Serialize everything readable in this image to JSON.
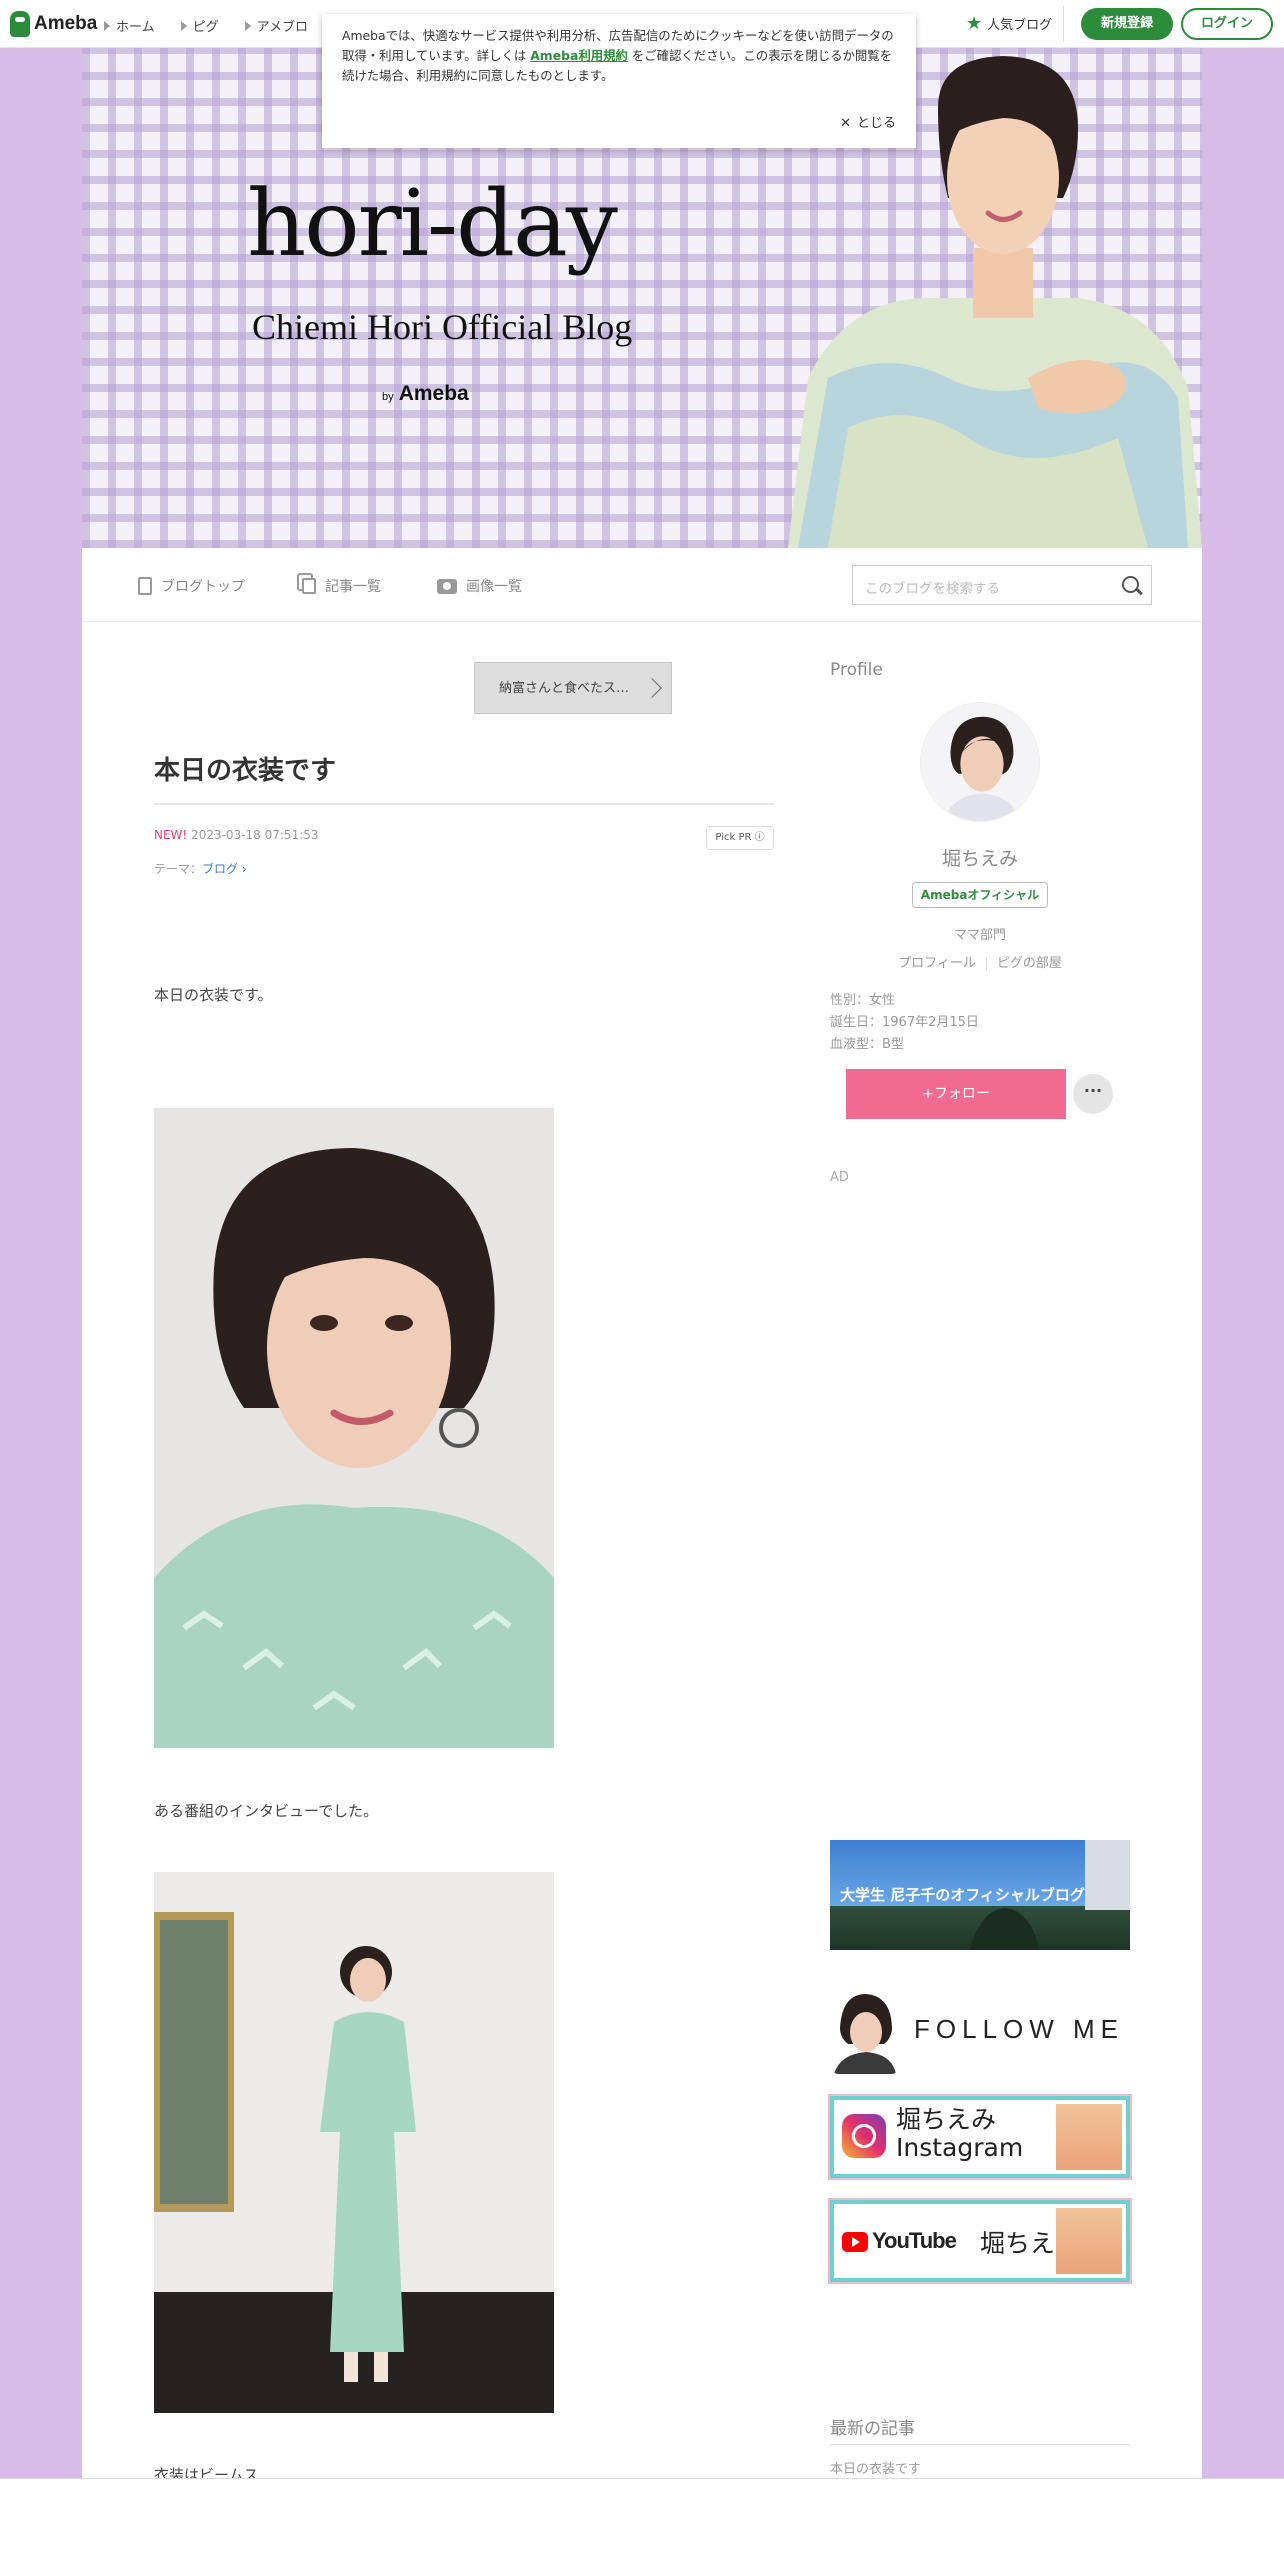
{
  "header": {
    "logo": "Ameba",
    "nav": [
      "ホーム",
      "ピグ",
      "アメブロ"
    ],
    "popular": "人気ブログ",
    "signup": "新規登録",
    "login": "ログイン",
    "accent_color": "#2d8c3c"
  },
  "cookie": {
    "text_before": "Amebaでは、快適なサービス提供や利用分析、広告配信のためにクッキーなどを使い訪問データの取得・利用しています。詳しくは",
    "link": "Ameba利用規約",
    "text_after": "をご確認ください。この表示を閉じるか閲覧を続けた場合、利用規約に同意したものとします。",
    "close": "とじる"
  },
  "banner": {
    "title": "hori-day",
    "subtitle": "Chiemi Hori Official Blog",
    "by": "by",
    "ameba": "Ameba"
  },
  "blognav": {
    "top": "ブログトップ",
    "entries": "記事一覧",
    "images": "画像一覧",
    "search_placeholder": "このブログを検索する"
  },
  "article": {
    "prev_link": "納富さんと食べたス…",
    "title": "本日の衣装です",
    "new_label": "NEW!",
    "date": "2023-03-18 07:51:53",
    "pickpr": "Pick PR ⓘ",
    "theme_label": "テーマ：",
    "theme": "ブログ",
    "p1": "本日の衣装です。",
    "p2": "ある番組のインタビューでした。",
    "p3": "衣装はビームス"
  },
  "profile": {
    "heading": "Profile",
    "name": "堀ちえみ",
    "official": "Amebaオフィシャル",
    "dept": "ママ部門",
    "link_profile": "プロフィール",
    "link_room": "ピグの部屋",
    "gender": "性別：女性",
    "birthday": "誕生日：1967年2月15日",
    "blood": "血液型：B型",
    "follow": "+フォロー",
    "more": "···",
    "ad": "AD"
  },
  "banners": {
    "daughter": "大学生 尼子千のオフィシャルブログ",
    "follow_me": "FOLLOW ME",
    "instagram_1": "堀ちえみ",
    "instagram_2": "Instagram",
    "youtube_word": "YouTube",
    "youtube_name": "堀ちえみ"
  },
  "latest": {
    "heading": "最新の記事",
    "item": "本日の衣装です"
  }
}
